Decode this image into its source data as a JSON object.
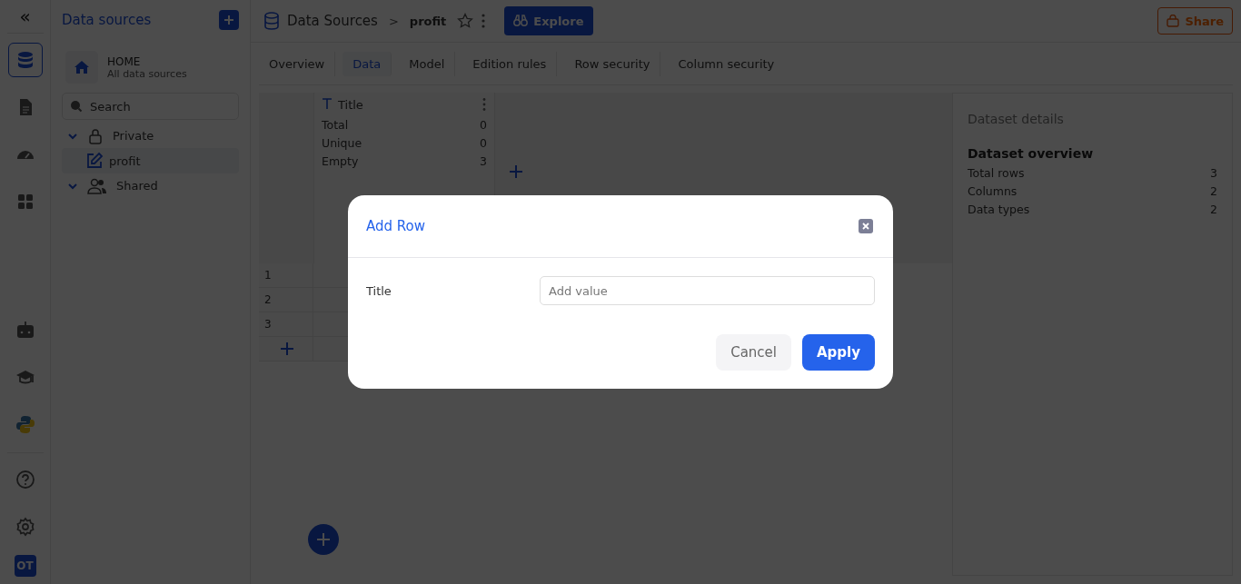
{
  "rail": [
    {
      "kind": "database",
      "selected": true
    },
    {
      "kind": "document",
      "selected": false
    },
    {
      "kind": "gauge",
      "selected": false
    },
    {
      "kind": "apps",
      "selected": false
    },
    {
      "kind": "robot",
      "selected": false
    },
    {
      "kind": "cap",
      "selected": false
    },
    {
      "kind": "python",
      "selected": false
    },
    {
      "kind": "help",
      "selected": false
    },
    {
      "kind": "settings",
      "selected": false
    }
  ],
  "avatar": "OT",
  "collapse": "«",
  "sidebar": {
    "title": "Data sources",
    "home": {
      "title": "HOME",
      "subtitle": "All data sources"
    },
    "search": {
      "placeholder": "Search"
    },
    "tree": [
      {
        "label": "Private",
        "kind": "lock",
        "expanded": true,
        "children": [
          {
            "label": "profit",
            "kind": "edit",
            "selected": true
          }
        ]
      },
      {
        "label": "Shared",
        "kind": "users",
        "expanded": true
      }
    ]
  },
  "header": {
    "breadcrumb": "Data Sources",
    "separator": ">",
    "current": "profit",
    "explore": "Explore",
    "share": "Share"
  },
  "tabs": [
    {
      "label": "Overview",
      "selected": false
    },
    {
      "label": "Data",
      "selected": true
    },
    {
      "label": "Model",
      "selected": false
    },
    {
      "label": "Edition rules",
      "selected": false
    },
    {
      "label": "Row security",
      "selected": false
    },
    {
      "label": "Column security",
      "selected": false
    }
  ],
  "column": {
    "name": "Title",
    "stats": [
      {
        "label": "Total",
        "value": "0"
      },
      {
        "label": "Unique",
        "value": "0"
      },
      {
        "label": "Empty",
        "value": "3"
      }
    ]
  },
  "rows": [
    "1",
    "2",
    "3"
  ],
  "details": {
    "title": "Dataset details",
    "subtitle": "Dataset overview",
    "items": [
      {
        "label": "Total rows",
        "value": "3"
      },
      {
        "label": "Columns",
        "value": "2"
      },
      {
        "label": "Data types",
        "value": "2"
      }
    ]
  },
  "modal": {
    "title": "Add Row",
    "field": {
      "label": "Title",
      "placeholder": "Add value"
    },
    "buttons": [
      {
        "label": "Cancel",
        "kind": "secondary"
      },
      {
        "label": "Apply",
        "kind": "primary"
      }
    ]
  }
}
